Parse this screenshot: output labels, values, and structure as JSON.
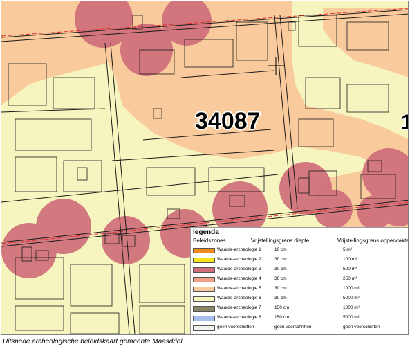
{
  "map": {
    "parcel_number": "34087",
    "edge_label": "1",
    "colors": {
      "zone5": "#f9cb9c",
      "zone6": "#f7f5bf",
      "zone3_circles": "#cf6e7a",
      "roads": "#1a1a1a",
      "boundary": "#e0302a"
    }
  },
  "legend": {
    "title": "legenda",
    "headers": {
      "zones": "Beleidszones",
      "depth": "Vrijstellingsgrens diepte",
      "area": "Vrijstellingsgrens oppervlakte"
    },
    "rows": [
      {
        "name": "Waarde-archeologie 1",
        "depth": "10 cm",
        "area": "5 m²",
        "color": "#f08a1c"
      },
      {
        "name": "Waarde-archeologie 2",
        "depth": "30 cm",
        "area": "100 m²",
        "color": "#f3e21c"
      },
      {
        "name": "Waarde-archeologie 3",
        "depth": "30 cm",
        "area": "500 m²",
        "color": "#cf6e7a"
      },
      {
        "name": "Waarde-archeologie 4",
        "depth": "30 cm",
        "area": "250 m²",
        "color": "#f2a086"
      },
      {
        "name": "Waarde-archeologie 5",
        "depth": "30 cm",
        "area": "1000 m²",
        "color": "#f9cb9c"
      },
      {
        "name": "Waarde-archeologie 6",
        "depth": "30 cm",
        "area": "5000 m²",
        "color": "#f7f5bf"
      },
      {
        "name": "Waarde-archeologie 7",
        "depth": "150 cm",
        "area": "1000 m²",
        "color": "#8c8467"
      },
      {
        "name": "Waarde-archeologie 8",
        "depth": "150 cm",
        "area": "5000 m²",
        "color": "#a9bff0"
      },
      {
        "name": "geen voorschriften",
        "depth": "geen voorschriften",
        "area": "geen voorschriften",
        "color": "#f2f2f2"
      }
    ]
  },
  "caption": "Uitsnede archeologische beleidskaart gemeente Maasdriel"
}
